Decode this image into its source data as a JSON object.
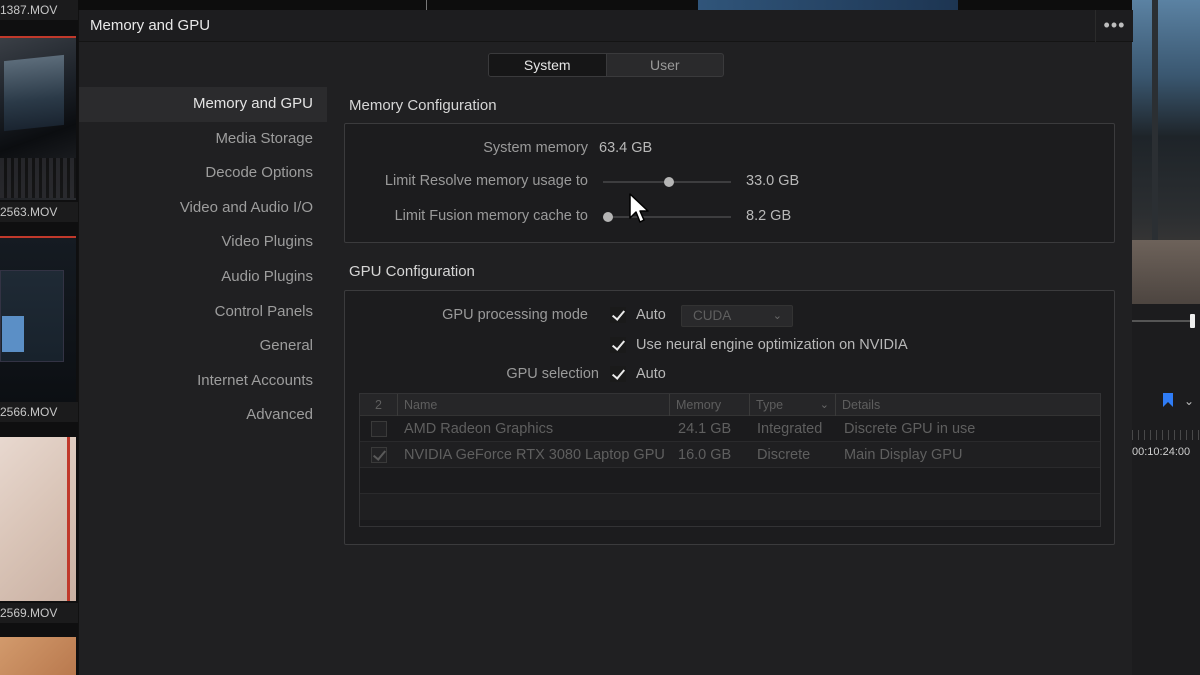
{
  "background": {
    "clips": [
      {
        "label": "1387.MOV"
      },
      {
        "label": "2563.MOV"
      },
      {
        "label": "2566.MOV"
      },
      {
        "label": "2569.MOV"
      }
    ],
    "timecode": "00:10:24:00"
  },
  "dialog": {
    "title": "Memory and GPU",
    "more_icon": "•••",
    "tabs": [
      {
        "label": "System",
        "active": true
      },
      {
        "label": "User",
        "active": false
      }
    ]
  },
  "sidebar": {
    "items": [
      {
        "label": "Memory and GPU",
        "active": true
      },
      {
        "label": "Media Storage"
      },
      {
        "label": "Decode Options"
      },
      {
        "label": "Video and Audio I/O"
      },
      {
        "label": "Video Plugins"
      },
      {
        "label": "Audio Plugins"
      },
      {
        "label": "Control Panels"
      },
      {
        "label": "General"
      },
      {
        "label": "Internet Accounts"
      },
      {
        "label": "Advanced"
      }
    ]
  },
  "memory": {
    "section_title": "Memory Configuration",
    "system_memory_label": "System memory",
    "system_memory_value": "63.4 GB",
    "resolve_limit_label": "Limit Resolve memory usage to",
    "resolve_limit_value": "33.0 GB",
    "resolve_limit_fraction": 0.52,
    "fusion_limit_label": "Limit Fusion memory cache to",
    "fusion_limit_value": "8.2 GB",
    "fusion_limit_fraction": 0.0
  },
  "gpu": {
    "section_title": "GPU Configuration",
    "processing_mode_label": "GPU processing mode",
    "processing_auto_label": "Auto",
    "processing_auto_checked": true,
    "processing_select_value": "CUDA",
    "neural_label": "Use neural engine optimization on NVIDIA",
    "neural_checked": true,
    "selection_label": "GPU selection",
    "selection_auto_label": "Auto",
    "selection_auto_checked": true,
    "table": {
      "headers": {
        "count": "2",
        "name": "Name",
        "memory": "Memory",
        "type": "Type",
        "details": "Details"
      },
      "rows": [
        {
          "checked": false,
          "name": "AMD Radeon Graphics",
          "memory": "24.1 GB",
          "type": "Integrated",
          "details": "Discrete GPU in use"
        },
        {
          "checked": true,
          "name": "NVIDIA GeForce RTX 3080 Laptop GPU",
          "memory": "16.0 GB",
          "type": "Discrete",
          "details": "Main Display GPU"
        }
      ]
    }
  },
  "colors": {
    "dialog_bg": "#202022",
    "accent_red": "#c0392b",
    "marker_blue": "#2f7cf6"
  }
}
